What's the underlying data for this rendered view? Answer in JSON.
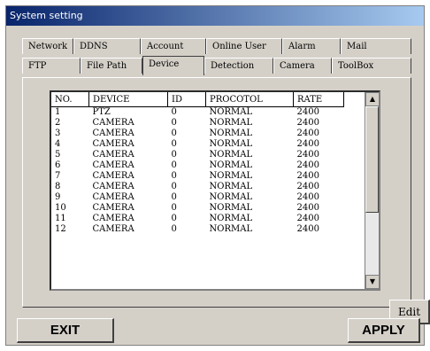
{
  "window": {
    "title": "System setting"
  },
  "tabs": {
    "row1": [
      "Network",
      "DDNS",
      "Account",
      "Online User",
      "Alarm",
      "Mail"
    ],
    "row2": [
      "FTP",
      "File Path",
      "Device",
      "Detection",
      "Camera",
      "ToolBox"
    ],
    "active": "Device"
  },
  "table": {
    "columns": [
      "NO.",
      "DEVICE",
      "ID",
      "PROCOTOL",
      "RATE"
    ],
    "rows": [
      [
        "1",
        "PTZ",
        "0",
        "NORMAL",
        "2400"
      ],
      [
        "2",
        "CAMERA",
        "0",
        "NORMAL",
        "2400"
      ],
      [
        "3",
        "CAMERA",
        "0",
        "NORMAL",
        "2400"
      ],
      [
        "4",
        "CAMERA",
        "0",
        "NORMAL",
        "2400"
      ],
      [
        "5",
        "CAMERA",
        "0",
        "NORMAL",
        "2400"
      ],
      [
        "6",
        "CAMERA",
        "0",
        "NORMAL",
        "2400"
      ],
      [
        "7",
        "CAMERA",
        "0",
        "NORMAL",
        "2400"
      ],
      [
        "8",
        "CAMERA",
        "0",
        "NORMAL",
        "2400"
      ],
      [
        "9",
        "CAMERA",
        "0",
        "NORMAL",
        "2400"
      ],
      [
        "10",
        "CAMERA",
        "0",
        "NORMAL",
        "2400"
      ],
      [
        "11",
        "CAMERA",
        "0",
        "NORMAL",
        "2400"
      ],
      [
        "12",
        "CAMERA",
        "0",
        "NORMAL",
        "2400"
      ]
    ]
  },
  "buttons": {
    "edit": "Edit",
    "exit": "EXIT",
    "apply": "APPLY"
  },
  "icons": {
    "scroll_up": "scroll-up-arrow-icon",
    "scroll_down": "scroll-down-arrow-icon"
  },
  "colors": {
    "titlebar_start": "#08246b",
    "titlebar_end": "#a6caf0",
    "face": "#d4d0c8"
  }
}
